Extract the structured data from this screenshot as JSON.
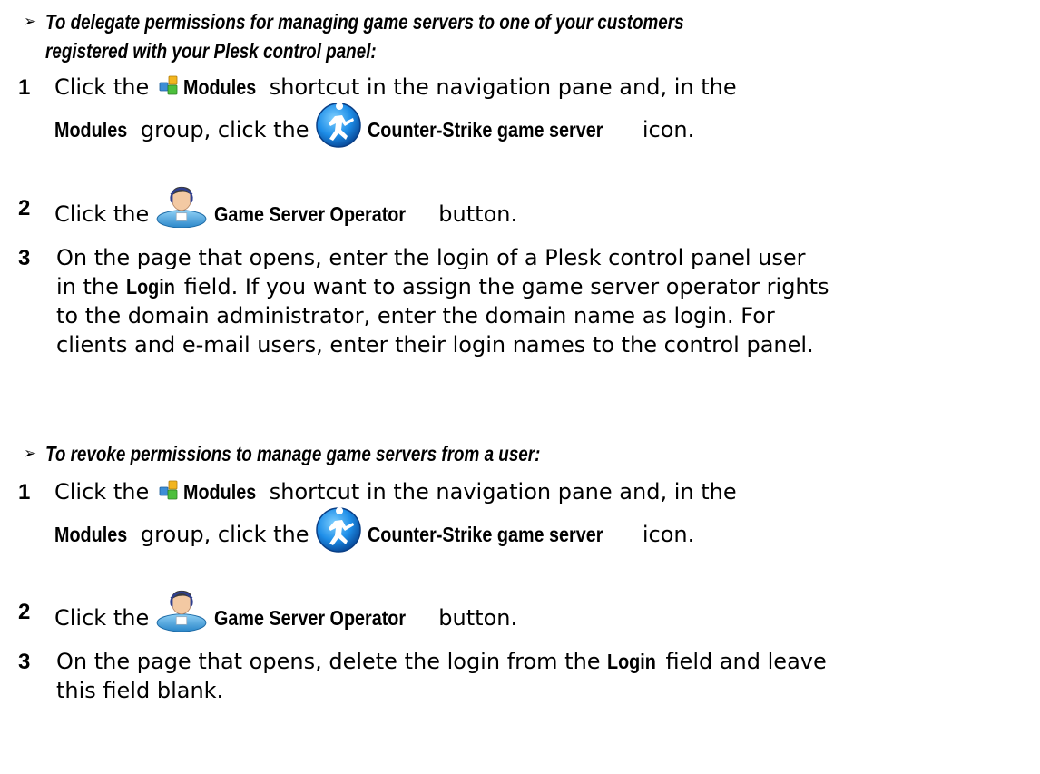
{
  "section1": {
    "arrow": "➢",
    "heading_line1": "To delegate permissions for managing game servers to one of your customers",
    "heading_line2": "registered with your Plesk control panel:",
    "steps": [
      {
        "num": "1",
        "a": "Click the",
        "b": "Modules",
        "c": "shortcut in the navigation pane and, in the",
        "d": "Modules",
        "e": "group, click the",
        "f": "Counter-Strike game server",
        "g": "icon."
      },
      {
        "num": "2",
        "a": "Click the",
        "b": "Game Server Operator",
        "c": "button."
      },
      {
        "num": "3",
        "a": "On the page that opens, enter the login of a Plesk control panel user",
        "b": "in the",
        "c": "Login",
        "d": "field. If you want to assign the game server operator rights",
        "e": "to the domain administrator, enter the domain name as login. For",
        "f": "clients and e-mail users, enter their login names to the control panel."
      }
    ]
  },
  "section2": {
    "arrow": "➢",
    "heading": "To revoke permissions to manage game servers from a user:",
    "steps": [
      {
        "num": "1",
        "a": "Click the",
        "b": "Modules",
        "c": "shortcut in the navigation pane and, in the",
        "d": "Modules",
        "e": "group, click the",
        "f": "Counter-Strike game server",
        "g": "icon."
      },
      {
        "num": "2",
        "a": "Click the",
        "b": "Game Server Operator",
        "c": "button."
      },
      {
        "num": "3",
        "a": "On the page that opens, delete the login from the",
        "b": "Login",
        "c": "field and leave",
        "d": "this field blank."
      }
    ]
  },
  "icons": {
    "modules": "modules-icon",
    "counter_strike": "counter-strike-icon",
    "operator": "game-server-operator-icon"
  }
}
